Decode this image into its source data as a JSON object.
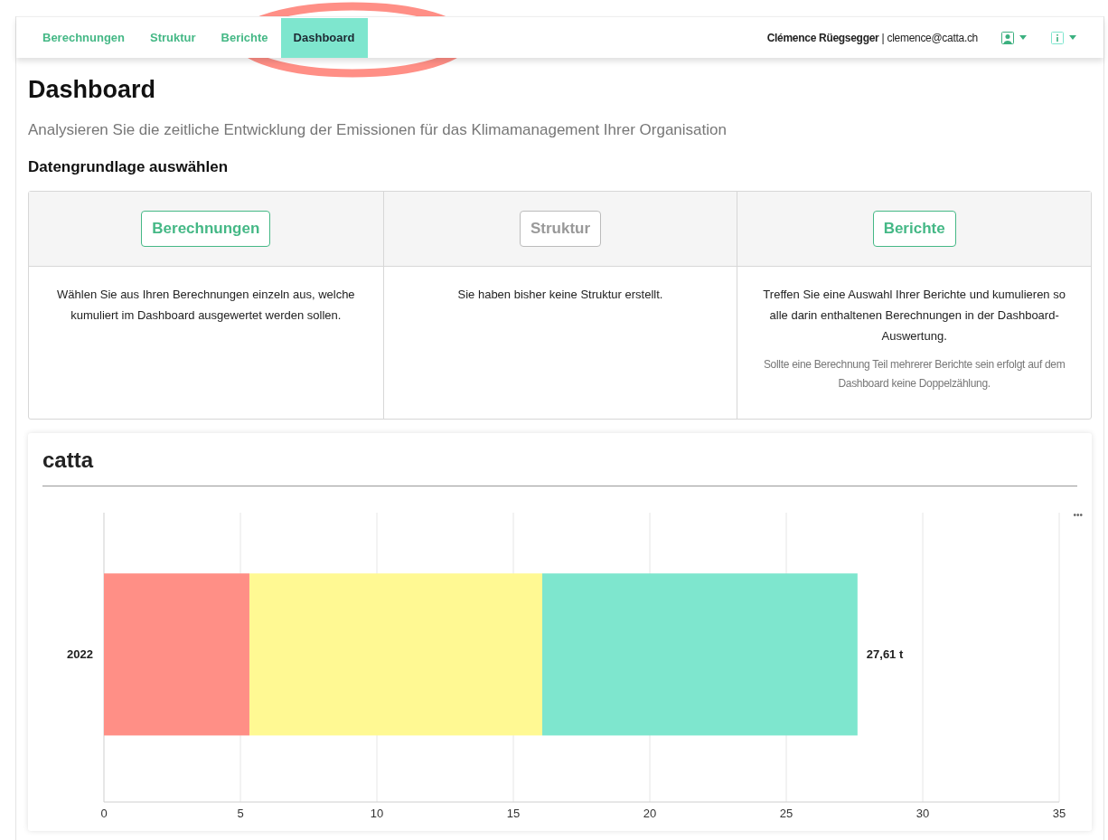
{
  "nav": {
    "tabs": [
      {
        "label": "Berechnungen",
        "selected": false
      },
      {
        "label": "Struktur",
        "selected": false
      },
      {
        "label": "Berichte",
        "selected": false
      },
      {
        "label": "Dashboard",
        "selected": true
      }
    ],
    "user_name": "Clémence Rüegsegger",
    "separator": "|",
    "user_email": "clemence@catta.ch"
  },
  "highlight": {
    "kind": "ellipse"
  },
  "page": {
    "title": "Dashboard",
    "subtitle": "Analysieren Sie die zeitliche Entwicklung der Emissionen für das Klimamanagement Ihrer Organisation",
    "section_title": "Datengrundlage auswählen"
  },
  "sources": [
    {
      "button": "Berechnungen",
      "disabled": false,
      "text": "Wählen Sie aus Ihren Berechnungen einzeln aus, welche kumuliert im Dashboard ausgewertet werden sollen."
    },
    {
      "button": "Struktur",
      "disabled": true,
      "text": "Sie haben bisher keine Struktur erstellt."
    },
    {
      "button": "Berichte",
      "disabled": false,
      "text": "Treffen Sie eine Auswahl Ihrer Berichte und kumulieren so alle darin enthaltenen Berechnungen in der Dashboard-Auswertung.",
      "note": "Sollte eine Berechnung Teil mehrerer Berichte sein erfolgt auf dem Dashboard keine Doppelzählung."
    }
  ],
  "chart_card": {
    "title": "catta",
    "menu": "•••",
    "chart_data": {
      "type": "bar",
      "orientation": "horizontal",
      "stacked": true,
      "categories": [
        "2022"
      ],
      "series": [
        {
          "color": "#ff8f86",
          "values": [
            5.33
          ]
        },
        {
          "color": "#fff993",
          "values": [
            10.73
          ]
        },
        {
          "color": "#7ee6ce",
          "values": [
            11.55
          ]
        }
      ],
      "grid": true,
      "xlim": [
        0,
        35
      ],
      "xticks": [
        0,
        5,
        10,
        15,
        20,
        25,
        30,
        35
      ],
      "annotations": [
        "27,61 t"
      ]
    }
  }
}
